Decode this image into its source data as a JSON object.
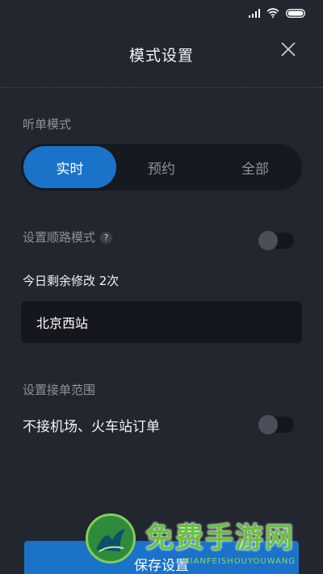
{
  "header": {
    "title": "模式设置"
  },
  "listen_mode": {
    "label": "听单模式",
    "options": [
      "实时",
      "预约",
      "全部"
    ],
    "selected": "实时"
  },
  "route_mode": {
    "label": "设置顺路模式",
    "help": "?",
    "enabled": false,
    "remaining": "今日剩余修改 2次",
    "station": "北京西站"
  },
  "range": {
    "label": "设置接单范围",
    "exclude_label": "不接机场、火车站订单",
    "exclude_enabled": false
  },
  "footer": {
    "save_label": "保存设置"
  },
  "watermark": {
    "text": "免费手游网",
    "sub": "MIANFEISHOUYOUWANG"
  },
  "colors": {
    "background": "#22262f",
    "accent": "#1a73c9",
    "field": "#14171d"
  }
}
